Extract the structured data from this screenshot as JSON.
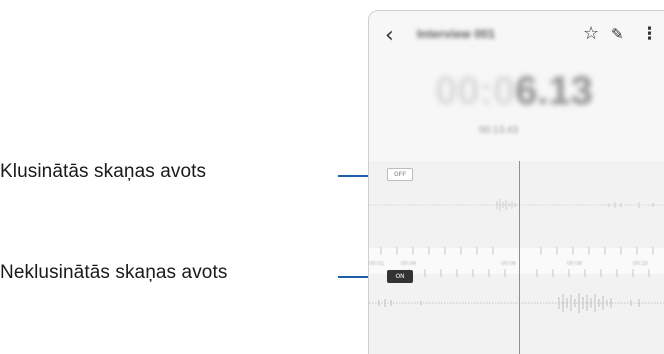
{
  "callouts": {
    "muted_source": "Klusinātās skaņas avots",
    "unmuted_source": "Neklusinātās skaņas avots"
  },
  "app_bar": {
    "back_icon": "chevron-left-icon",
    "title": "Interview 001",
    "actions": [
      "star-icon",
      "pencil-icon",
      "more-options-icon"
    ]
  },
  "timer": {
    "dim": "00:0",
    "bright": "6.13",
    "subtext": "00:13:43"
  },
  "tracks": {
    "muted_badge": "OFF",
    "unmuted_badge": "ON"
  },
  "ruler": {
    "labels": [
      "00:02",
      "00:04",
      "00:06",
      "00:08",
      "00:10"
    ]
  },
  "colors": {
    "leader_line": "#1d5fa8",
    "playhead": "#e66a6a",
    "on_badge": "#333333"
  }
}
